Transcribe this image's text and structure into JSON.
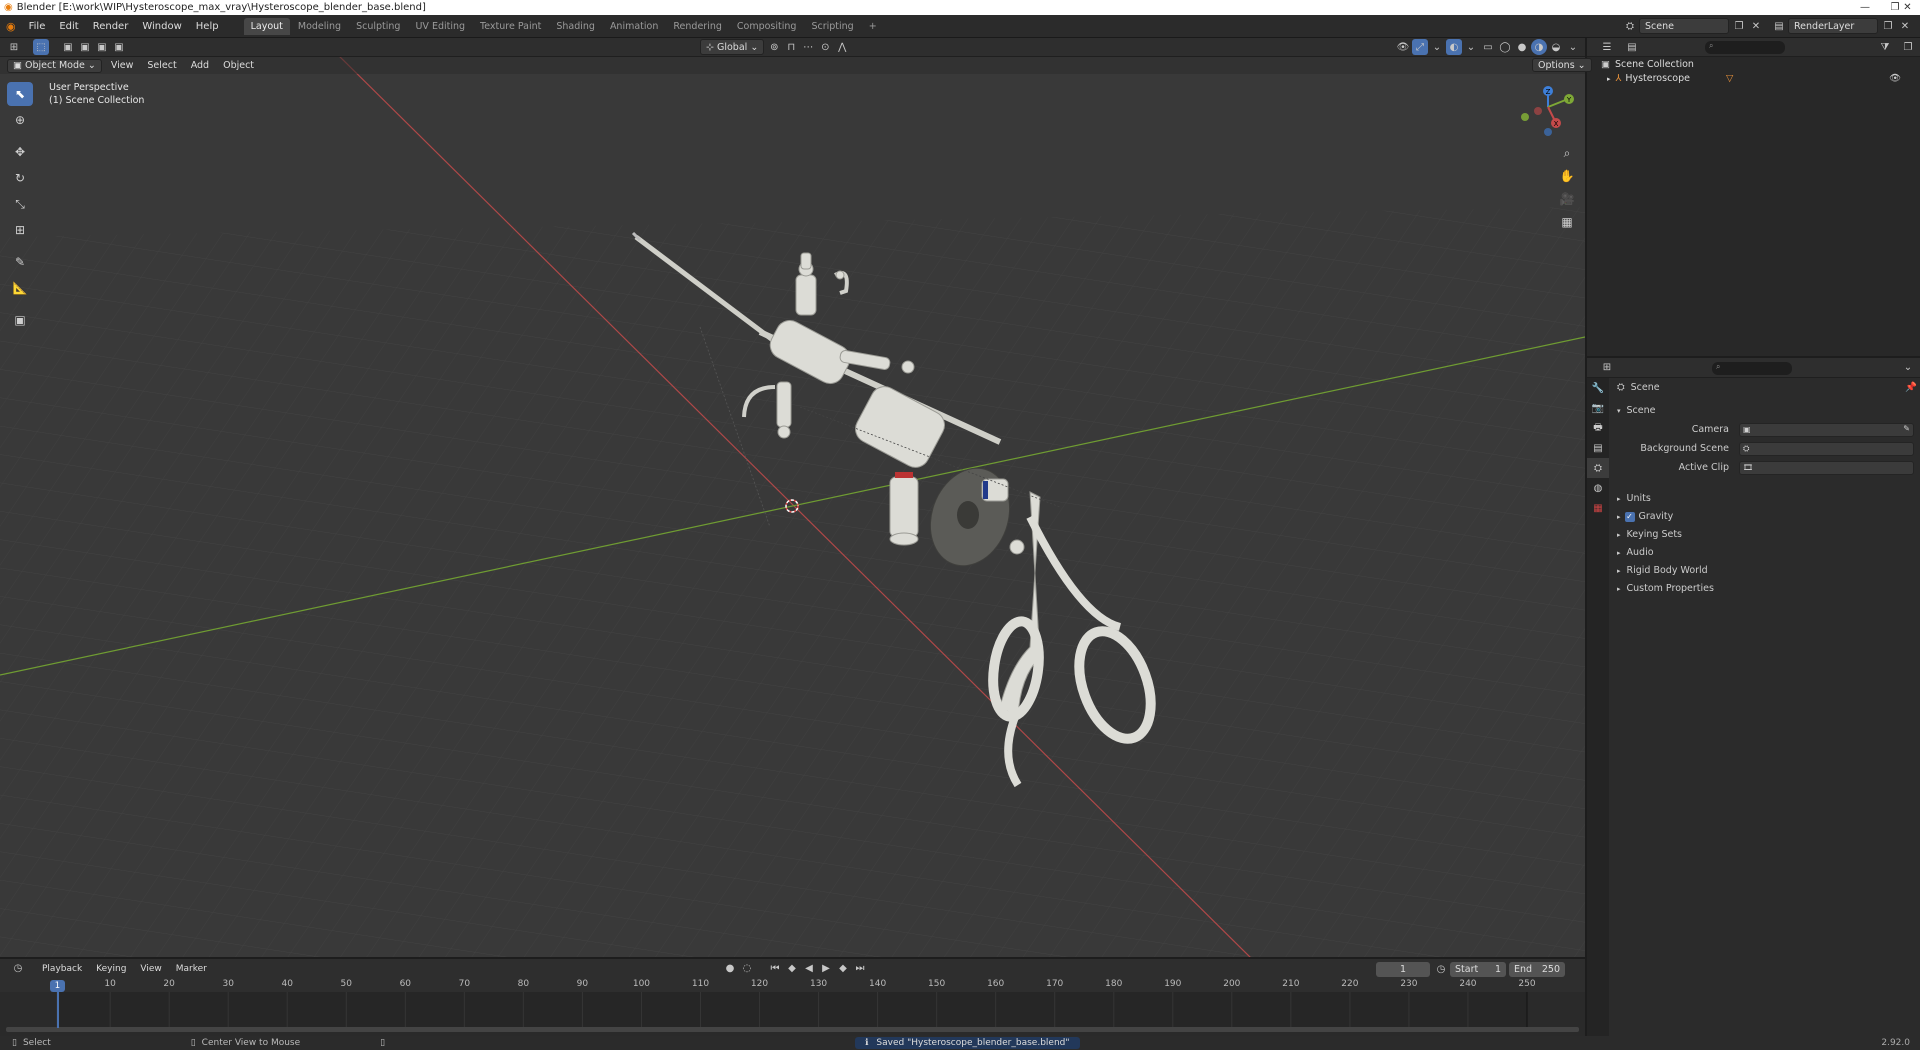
{
  "window": {
    "title": "Blender [E:\\work\\WIP\\Hysteroscope_max_vray\\Hysteroscope_blender_base.blend]"
  },
  "menus": [
    "File",
    "Edit",
    "Render",
    "Window",
    "Help"
  ],
  "workspaces": [
    "Layout",
    "Modeling",
    "Sculpting",
    "UV Editing",
    "Texture Paint",
    "Shading",
    "Animation",
    "Rendering",
    "Compositing",
    "Scripting"
  ],
  "active_workspace": "Layout",
  "scene_selector": {
    "scene": "Scene",
    "view_layer": "RenderLayer"
  },
  "viewport": {
    "mode": "Object Mode",
    "header_menus": [
      "View",
      "Select",
      "Add",
      "Object"
    ],
    "orientation": "Global",
    "options_label": "Options",
    "overlay_title": "User Perspective",
    "overlay_collection": "(1) Scene Collection",
    "gizmo": {
      "x": "X",
      "y": "Y",
      "z": "Z"
    }
  },
  "outliner": {
    "root": "Scene Collection",
    "items": [
      "Hysteroscope"
    ]
  },
  "properties": {
    "context": "Scene",
    "panel": "Scene",
    "fields": [
      {
        "label": "Camera"
      },
      {
        "label": "Background Scene"
      },
      {
        "label": "Active Clip"
      }
    ],
    "subpanels": [
      "Units",
      "Gravity",
      "Keying Sets",
      "Audio",
      "Rigid Body World",
      "Custom Properties"
    ],
    "gravity_checked": true
  },
  "timeline": {
    "menus": [
      "Playback",
      "Keying",
      "View",
      "Marker"
    ],
    "current_frame": "1",
    "start_label": "Start",
    "start": "1",
    "end_label": "End",
    "end": "250",
    "ticks": [
      "1",
      "10",
      "20",
      "30",
      "40",
      "50",
      "60",
      "70",
      "80",
      "90",
      "100",
      "110",
      "120",
      "130",
      "140",
      "150",
      "160",
      "170",
      "180",
      "190",
      "200",
      "210",
      "220",
      "230",
      "240",
      "250"
    ]
  },
  "statusbar": {
    "left": "Select",
    "middle": "Center View to Mouse",
    "message": "Saved \"Hysteroscope_blender_base.blend\"",
    "version": "2.92.0"
  },
  "colors": {
    "accent": "#4a72b0",
    "x_axis": "#c44a4a",
    "y_axis": "#7ea836",
    "z_axis": "#3d7fd9"
  }
}
